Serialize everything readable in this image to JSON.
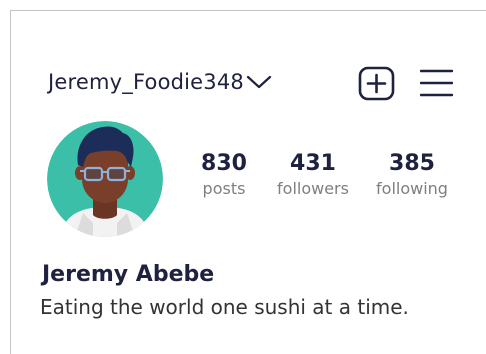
{
  "header": {
    "username": "Jeremy_Foodie348"
  },
  "stats": {
    "posts": {
      "count": "830",
      "label": "posts"
    },
    "followers": {
      "count": "431",
      "label": "followers"
    },
    "following": {
      "count": "385",
      "label": "following"
    }
  },
  "profile": {
    "name": "Jeremy Abebe",
    "bio": "Eating the world one sushi at a time."
  },
  "colors": {
    "text_primary": "#1f2140",
    "text_secondary": "#7f7f7f",
    "avatar_background": "#3bbfa9",
    "skin": "#7a3f2b",
    "hair": "#1d2d5a"
  },
  "icons": {
    "account_switcher": "chevron-down-icon",
    "create": "plus-square-icon",
    "menu": "hamburger-menu-icon",
    "avatar": "person-with-glasses-illustration"
  }
}
